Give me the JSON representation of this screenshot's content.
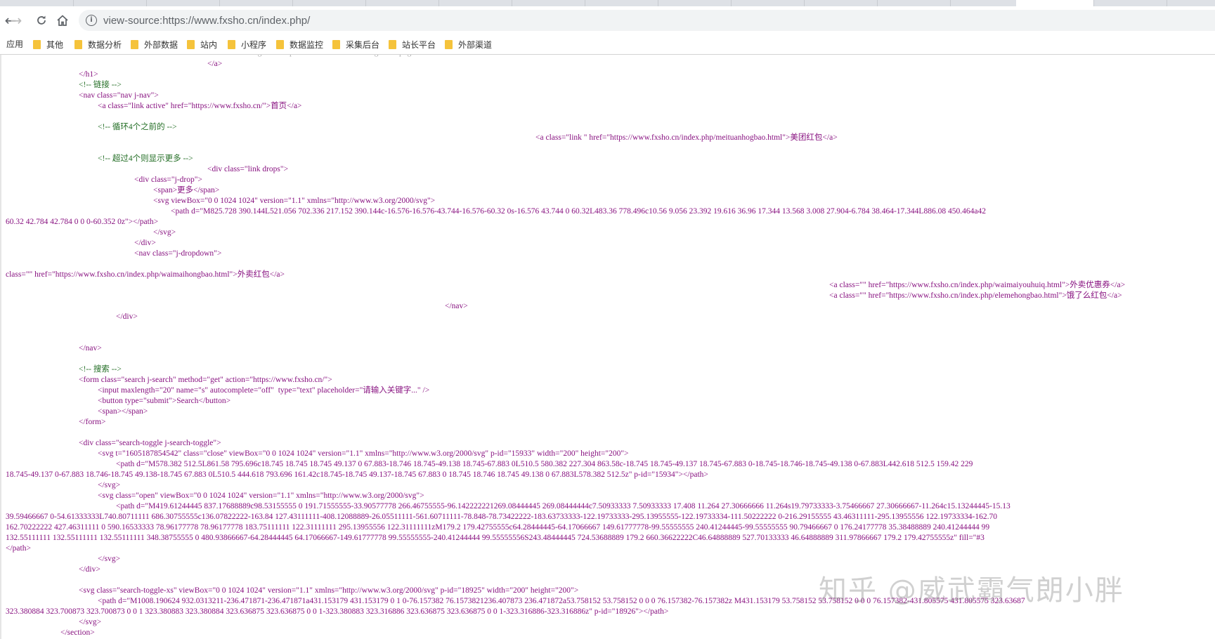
{
  "browser": {
    "url": "view-source:https://www.fxsho.cn/index.php/",
    "nav": {
      "back": "←",
      "forward": "→",
      "reload": "⟳",
      "home": "⌂"
    },
    "info_icon": "i"
  },
  "bookmarks": {
    "apps_label": "应用",
    "items": [
      "其他",
      "数据分析",
      "外部数据",
      "站内",
      "小程序",
      "数据监控",
      "采集后台",
      "站长平台",
      "外部渠道"
    ]
  },
  "source_lines": [
    "</a>",
    "</h1>",
    "<!-- 链接 -->",
    "<nav class=\"nav j-nav\">",
    "<a class=\"link active\" href=\"https://www.fxsho.cn/\">首页</a>",
    "<!-- 循环4个之前的 -->",
    "<a class=\"link \" href=\"https://www.fxsho.cn/index.php/meituanhogbao.html\">美团红包</a>",
    "<!-- 超过4个则显示更多 -->",
    "<div class=\"link drops\">",
    "<div class=\"j-drop\">",
    "<span>更多</span>",
    "<svg viewBox=\"0 0 1024 1024\" version=\"1.1\" xmlns=\"http://www.w3.org/2000/svg\">",
    "<path d=\"M825.728 390.144L521.056 702.336 217.152 390.144c-16.576-16.576-43.744-16.576-60.32 0s-16.576 43.744 0 60.32L483.36 778.496c10.56 9.056 23.392 19.616 36.96 17.344 13.568 3.008 27.904-6.784 38.464-17.344L886.08 450.464a42",
    "60.32 42.784 42.784 0 0 0-60.352 0z\"></path>",
    "</svg>",
    "</div>",
    "<nav class=\"j-dropdown\">",
    "class=\"\" href=\"https://www.fxsho.cn/index.php/waimaihongbao.html\">外卖红包</a>",
    "<a class=\"\" href=\"https://www.fxsho.cn/index.php/waimaiyouhuiq.html\">外卖优惠券</a>",
    "<a class=\"\" href=\"https://www.fxsho.cn/index.php/elemehongbao.html\">饿了么红包</a>",
    "</nav>",
    "</div>",
    "</nav>",
    "<!-- 搜索 -->",
    "<form class=\"search j-search\" method=\"get\" action=\"https://www.fxsho.cn/\">",
    "<input maxlength=\"20\" name=\"s\" autocomplete=\"off\"  type=\"text\" placeholder=\"请输入关键字...\" />",
    "<button type=\"submit\">Search</button>",
    "<span></span>",
    "</form>",
    "<div class=\"search-toggle j-search-toggle\">",
    "<svg t=\"1605187854542\" class=\"close\" viewBox=\"0 0 1024 1024\" version=\"1.1\" xmlns=\"http://www.w3.org/2000/svg\" p-id=\"15933\" width=\"200\" height=\"200\">",
    "<path d=\"M578.382 512.5L861.58 795.696c18.745 18.745 18.745 49.137 0 67.883-18.746 18.745-49.138 18.745-67.883 0L510.5 580.382 227.304 863.58c-18.745 18.745-49.137 18.745-67.883 0-18.745-18.746-18.745-49.138 0-67.883L442.618 512.5 159.42 229",
    "18.745-49.137 0-67.883 18.746-18.745 49.138-18.745 67.883 0L510.5 444.618 793.696 161.42c18.745-18.745 49.137-18.745 67.883 0 18.745 18.746 18.745 49.138 0 67.883L578.382 512.5z\" p-id=\"15934\"></path>",
    "</svg>",
    "<svg class=\"open\" viewBox=\"0 0 1024 1024\" version=\"1.1\" xmlns=\"http://www.w3.org/2000/svg\">",
    "<path d=\"M419.61244445 837.17688889c98.53155555 0 191.71555555-33.90577778 266.46755555-96.142222221269.08444445 269.08444444c7.50933333 7.50933333 17.408 11.264 27.30666666 11.264s19.79733333-3.75466667 27.30666667-11.264c15.13244445-15.13",
    "39.59466667 0-54.61333333L740.80711111 686.30755555c136.07822222-163.84 127.43111111-408.12088889-26.05511111-561.60711111-78.848-78.73422222-183.63733333-122.19733333-295.13955555-122.19733334-111.50222222 0-216.29155555 43.46311111-295.13955556 122.19733334-162.70",
    "162.70222222 427.46311111 0 590.16533333 78.96177778 78.96177778 183.75111111 122.31111111 295.13955556 122.31111111zM179.2 179.42755555c64.28444445-64.17066667 149.61777778-99.55555555 240.41244445-99.55555555 90.79466667 0 176.24177778 35.38488889 240.41244444 99",
    "132.55111111 132.55111111 132.55111111 348.38755555 0 480.93866667-64.28444445 64.17066667-149.61777778 99.55555555-240.41244444 99.55555556S243.48444445 724.53688889 179.2 660.36622222C46.64888889 527.70133333 46.64888889 311.97866667 179.2 179.42755555z\" fill=\"#3",
    "</path>",
    "</svg>",
    "</div>",
    "<svg class=\"search-toggle-xs\" viewBox=\"0 0 1024 1024\" version=\"1.1\" xmlns=\"http://www.w3.org/2000/svg\" p-id=\"18925\" width=\"200\" height=\"200\">",
    "<path d=\"M1008.190624 932.0313211-236.471871-236.471871a431.153179 431.153179 0 1 0-76.157382 76.1573821236.407873 236.471872a53.758152 53.758152 0 0 0 76.157382-76.157382z M431.153179 53.758152 53.758152 0 0 0 76.157382-431.805575 431.805575 323.63687",
    "323.380884 323.700873 323.700873 0 0 1 323.380883 323.380884 323.636875 323.636875 0 0 1-323.380883 323.316886 323.636875 323.636875 0 0 1-323.316886-323.316886z\" p-id=\"18926\"></path>",
    "</svg>",
    "</section>"
  ],
  "watermark": "知乎 @威武霸气朗小胖"
}
